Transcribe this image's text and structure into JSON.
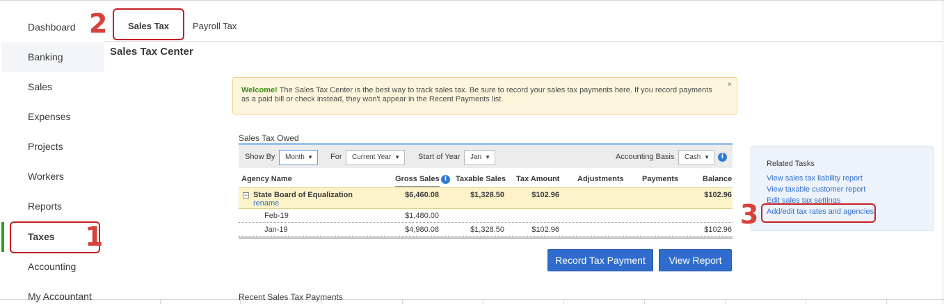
{
  "sidebar": {
    "items": [
      {
        "label": "Dashboard"
      },
      {
        "label": "Banking"
      },
      {
        "label": "Sales"
      },
      {
        "label": "Expenses"
      },
      {
        "label": "Projects"
      },
      {
        "label": "Workers"
      },
      {
        "label": "Reports"
      },
      {
        "label": "Taxes"
      },
      {
        "label": "Accounting"
      },
      {
        "label": "My Accountant"
      }
    ],
    "active": "Taxes"
  },
  "tabs": [
    {
      "label": "Sales Tax"
    },
    {
      "label": "Payroll Tax"
    }
  ],
  "page": {
    "title": "Sales Tax Center"
  },
  "banner": {
    "bold": "Welcome!",
    "text": "The Sales Tax Center is the best way to track sales tax. Be sure to record your sales tax payments here. If you record payments as a paid bill or check instead, they won't appear in the Recent Payments list.",
    "close": "×"
  },
  "owed": {
    "title": "Sales Tax Owed",
    "show_by_label": "Show By",
    "show_by_value": "Month",
    "for_label": "For",
    "for_value": "Current Year",
    "start_label": "Start of Year",
    "start_value": "Jan",
    "basis_label": "Accounting Basis",
    "basis_value": "Cash",
    "columns": [
      "Agency Name",
      "Gross Sales",
      "Taxable Sales",
      "Tax Amount",
      "Adjustments",
      "Payments",
      "Balance"
    ],
    "agency": {
      "name": "State Board of Equalization",
      "rename": "rename",
      "collapse": "−",
      "gross": "$6,460.08",
      "taxable": "$1,328.50",
      "tax": "$102.96",
      "balance": "$102.96"
    },
    "rows": [
      {
        "period": "Feb-19",
        "gross": "$1,480.00",
        "taxable": "",
        "tax": "",
        "balance": ""
      },
      {
        "period": "Jan-19",
        "gross": "$4,980.08",
        "taxable": "$1,328.50",
        "tax": "$102.96",
        "balance": "$102.96"
      }
    ],
    "record_button": "Record Tax Payment",
    "view_button": "View Report"
  },
  "recent": {
    "title": "Recent Sales Tax Payments"
  },
  "related": {
    "title": "Related Tasks",
    "links": [
      "View sales tax liability report",
      "View taxable customer report",
      "Edit sales tax settings",
      "Add/edit tax rates and agencies"
    ]
  },
  "annotations": [
    "1",
    "2",
    "3"
  ],
  "colors": {
    "accent_green": "#2ca01c",
    "link_blue": "#2f6fcd",
    "button_blue": "#2f6ccd",
    "annotation_red": "#c51f24"
  }
}
